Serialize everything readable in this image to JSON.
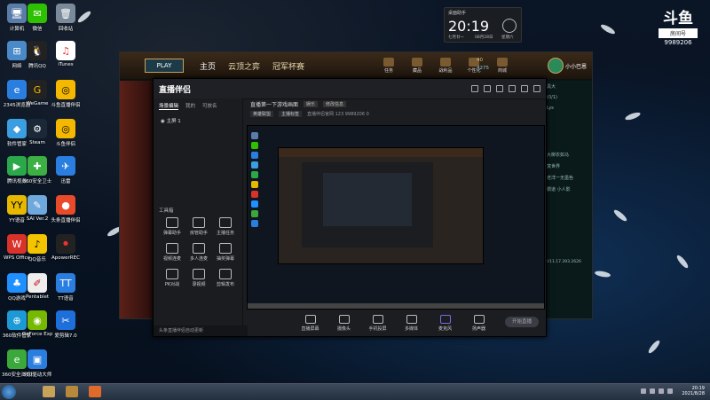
{
  "desktop": {
    "icons_col1": [
      "计算机",
      "网络",
      "2345浏览器",
      "软件管家",
      "腾讯视频",
      "YY语音",
      "WPS Office",
      "QQ游戏",
      "360软件管家",
      "360安全浏览器"
    ],
    "icons_col2": [
      "微信",
      "腾讯QQ",
      "WeGame",
      "Steam",
      "360安全卫士",
      "SAI Ver.2",
      "QQ音乐",
      "Pentablet",
      "GeForce Experience",
      "360驱动大师"
    ],
    "icons_col3": [
      "回收站",
      "iTunes",
      "斗鱼直播伴侣",
      "斗鱼伴侣",
      "迅雷",
      "头条直播伴侣",
      "ApowerREC",
      "TT语音",
      "爱剪辑7.0"
    ]
  },
  "widget": {
    "caption": "桌面助手",
    "time": "20:19",
    "date": "七月廿一",
    "date2": "08月28日",
    "weekday": "星期六"
  },
  "brand": {
    "logo": "斗鱼",
    "label": "房间号",
    "room": "9989206"
  },
  "lol": {
    "play": "PLAY",
    "nav": [
      "主页",
      "云顶之弈",
      "冠军杯赛"
    ],
    "resources": [
      "任务",
      "藏品",
      "战利品",
      "个性化",
      "商城"
    ],
    "currency1": "40",
    "currency2": "4275",
    "username": "小小巴恩",
    "chat": [
      "黑大",
      "(0/1)",
      "Lys",
      "大柳衣如马",
      "寞世界",
      "老洋一无墨色",
      "霸道 小人影"
    ],
    "version": "V11.17.393.2626"
  },
  "app": {
    "title": "直播伴侣",
    "tabs": [
      "场景编辑",
      "我的",
      "可放名"
    ],
    "scene": "主屏 1",
    "tools_header": "工具箱",
    "tools": [
      "弹幕助手",
      "房管助手",
      "主播任务",
      "视频连麦",
      "多人连麦",
      "抽奖弹幕",
      "PK对战",
      "录视频",
      "剪辑发布"
    ],
    "footer": "头条直播伴侣自动更新",
    "room_title": "直播第一下游戏画面",
    "room_tag": "娱乐",
    "room_btn": "修改信息",
    "meta_chip1": "英雄联盟",
    "meta_chip2": "主播标签",
    "meta_text": "直播伴侣官网 123   9989206   0",
    "controls": [
      "直播屏幕",
      "摄像头",
      "手机投屏",
      "多媒体",
      "麦克风",
      "扬声器"
    ],
    "golive": "开始直播"
  },
  "taskbar": {
    "time": "20:19",
    "date": "2021/8/28"
  }
}
